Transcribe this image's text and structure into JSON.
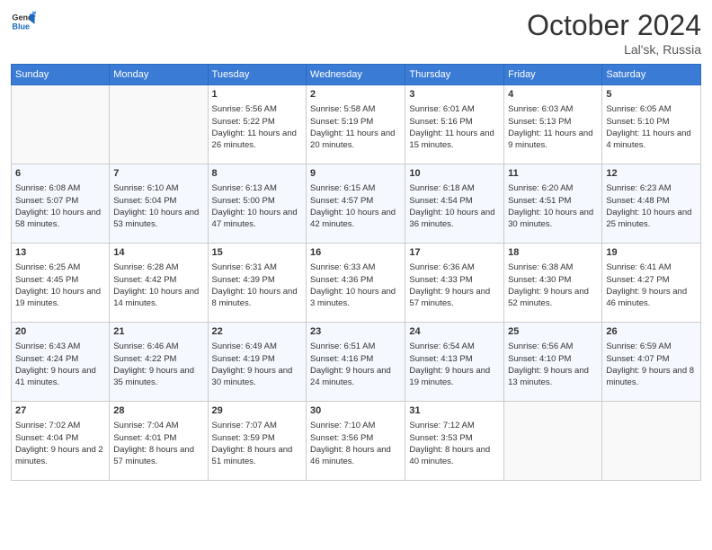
{
  "header": {
    "logo_line1": "General",
    "logo_line2": "Blue",
    "month": "October 2024",
    "location": "Lal'sk, Russia"
  },
  "days_of_week": [
    "Sunday",
    "Monday",
    "Tuesday",
    "Wednesday",
    "Thursday",
    "Friday",
    "Saturday"
  ],
  "weeks": [
    [
      {
        "day": "",
        "content": ""
      },
      {
        "day": "",
        "content": ""
      },
      {
        "day": "1",
        "content": "Sunrise: 5:56 AM\nSunset: 5:22 PM\nDaylight: 11 hours and 26 minutes."
      },
      {
        "day": "2",
        "content": "Sunrise: 5:58 AM\nSunset: 5:19 PM\nDaylight: 11 hours and 20 minutes."
      },
      {
        "day": "3",
        "content": "Sunrise: 6:01 AM\nSunset: 5:16 PM\nDaylight: 11 hours and 15 minutes."
      },
      {
        "day": "4",
        "content": "Sunrise: 6:03 AM\nSunset: 5:13 PM\nDaylight: 11 hours and 9 minutes."
      },
      {
        "day": "5",
        "content": "Sunrise: 6:05 AM\nSunset: 5:10 PM\nDaylight: 11 hours and 4 minutes."
      }
    ],
    [
      {
        "day": "6",
        "content": "Sunrise: 6:08 AM\nSunset: 5:07 PM\nDaylight: 10 hours and 58 minutes."
      },
      {
        "day": "7",
        "content": "Sunrise: 6:10 AM\nSunset: 5:04 PM\nDaylight: 10 hours and 53 minutes."
      },
      {
        "day": "8",
        "content": "Sunrise: 6:13 AM\nSunset: 5:00 PM\nDaylight: 10 hours and 47 minutes."
      },
      {
        "day": "9",
        "content": "Sunrise: 6:15 AM\nSunset: 4:57 PM\nDaylight: 10 hours and 42 minutes."
      },
      {
        "day": "10",
        "content": "Sunrise: 6:18 AM\nSunset: 4:54 PM\nDaylight: 10 hours and 36 minutes."
      },
      {
        "day": "11",
        "content": "Sunrise: 6:20 AM\nSunset: 4:51 PM\nDaylight: 10 hours and 30 minutes."
      },
      {
        "day": "12",
        "content": "Sunrise: 6:23 AM\nSunset: 4:48 PM\nDaylight: 10 hours and 25 minutes."
      }
    ],
    [
      {
        "day": "13",
        "content": "Sunrise: 6:25 AM\nSunset: 4:45 PM\nDaylight: 10 hours and 19 minutes."
      },
      {
        "day": "14",
        "content": "Sunrise: 6:28 AM\nSunset: 4:42 PM\nDaylight: 10 hours and 14 minutes."
      },
      {
        "day": "15",
        "content": "Sunrise: 6:31 AM\nSunset: 4:39 PM\nDaylight: 10 hours and 8 minutes."
      },
      {
        "day": "16",
        "content": "Sunrise: 6:33 AM\nSunset: 4:36 PM\nDaylight: 10 hours and 3 minutes."
      },
      {
        "day": "17",
        "content": "Sunrise: 6:36 AM\nSunset: 4:33 PM\nDaylight: 9 hours and 57 minutes."
      },
      {
        "day": "18",
        "content": "Sunrise: 6:38 AM\nSunset: 4:30 PM\nDaylight: 9 hours and 52 minutes."
      },
      {
        "day": "19",
        "content": "Sunrise: 6:41 AM\nSunset: 4:27 PM\nDaylight: 9 hours and 46 minutes."
      }
    ],
    [
      {
        "day": "20",
        "content": "Sunrise: 6:43 AM\nSunset: 4:24 PM\nDaylight: 9 hours and 41 minutes."
      },
      {
        "day": "21",
        "content": "Sunrise: 6:46 AM\nSunset: 4:22 PM\nDaylight: 9 hours and 35 minutes."
      },
      {
        "day": "22",
        "content": "Sunrise: 6:49 AM\nSunset: 4:19 PM\nDaylight: 9 hours and 30 minutes."
      },
      {
        "day": "23",
        "content": "Sunrise: 6:51 AM\nSunset: 4:16 PM\nDaylight: 9 hours and 24 minutes."
      },
      {
        "day": "24",
        "content": "Sunrise: 6:54 AM\nSunset: 4:13 PM\nDaylight: 9 hours and 19 minutes."
      },
      {
        "day": "25",
        "content": "Sunrise: 6:56 AM\nSunset: 4:10 PM\nDaylight: 9 hours and 13 minutes."
      },
      {
        "day": "26",
        "content": "Sunrise: 6:59 AM\nSunset: 4:07 PM\nDaylight: 9 hours and 8 minutes."
      }
    ],
    [
      {
        "day": "27",
        "content": "Sunrise: 7:02 AM\nSunset: 4:04 PM\nDaylight: 9 hours and 2 minutes."
      },
      {
        "day": "28",
        "content": "Sunrise: 7:04 AM\nSunset: 4:01 PM\nDaylight: 8 hours and 57 minutes."
      },
      {
        "day": "29",
        "content": "Sunrise: 7:07 AM\nSunset: 3:59 PM\nDaylight: 8 hours and 51 minutes."
      },
      {
        "day": "30",
        "content": "Sunrise: 7:10 AM\nSunset: 3:56 PM\nDaylight: 8 hours and 46 minutes."
      },
      {
        "day": "31",
        "content": "Sunrise: 7:12 AM\nSunset: 3:53 PM\nDaylight: 8 hours and 40 minutes."
      },
      {
        "day": "",
        "content": ""
      },
      {
        "day": "",
        "content": ""
      }
    ]
  ]
}
